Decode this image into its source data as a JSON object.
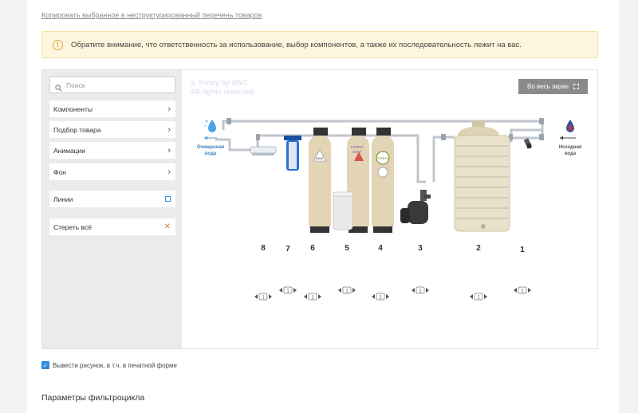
{
  "copy_link": "Копировать выбранное в неструктурированный перечень товаров",
  "notice": {
    "icon": "exclamation-icon",
    "text": "Обратите внимание, что ответственность за использование, выбор компонентов, а также их последовательность лежит на вас."
  },
  "sidebar": {
    "search_placeholder": "Поиск",
    "items": [
      {
        "label": "Компоненты"
      },
      {
        "label": "Подбор товара"
      },
      {
        "label": "Анимации"
      },
      {
        "label": "Фон"
      }
    ],
    "lines_label": "Линии",
    "clear_label": "Стереть всё"
  },
  "canvas": {
    "watermark_line1": "© Trinity by AWT.",
    "watermark_line2": "All rights reserved.",
    "fullscreen_label": "Во весь экран",
    "outlet_label_1": "Очищенная",
    "outlet_label_2": "вода",
    "inlet_label_1": "Исходная",
    "inlet_label_2": "вода",
    "positions": [
      "8",
      "7",
      "6",
      "5",
      "4",
      "3",
      "2",
      "1"
    ],
    "badge_ak": "AKAT",
    "badge_ferro1": "FERRO",
    "badge_ferro2": "SOFT",
    "control_glyph": "1"
  },
  "print_option": "Вывести рисунок, в т.ч. в печатной форме",
  "params_title": "Параметры фильтроцикла",
  "colors": {
    "accent": "#2d8ce0",
    "notice_bg": "#fdf6dc",
    "warning": "#e2a53c"
  }
}
